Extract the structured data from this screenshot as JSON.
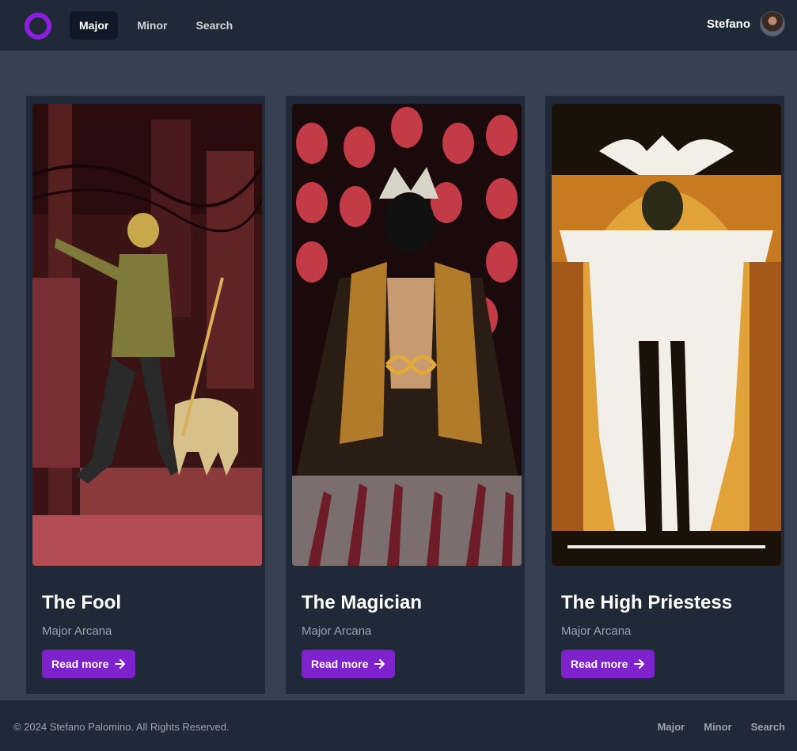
{
  "header": {
    "logo_icon": "ring-logo-icon",
    "nav": [
      {
        "label": "Major",
        "active": true
      },
      {
        "label": "Minor",
        "active": false
      },
      {
        "label": "Search",
        "active": false
      }
    ],
    "user_name": "Stefano"
  },
  "cards": [
    {
      "title": "The Fool",
      "subtitle": "Major Arcana",
      "button": "Read more"
    },
    {
      "title": "The Magician",
      "subtitle": "Major Arcana",
      "button": "Read more"
    },
    {
      "title": "The High Priestess",
      "subtitle": "Major Arcana",
      "button": "Read more"
    }
  ],
  "footer": {
    "copyright": "© 2024 Stefano Palomino. All Rights Reserved.",
    "nav": [
      "Major",
      "Minor",
      "Search"
    ]
  },
  "colors": {
    "accent": "#7e22ce",
    "logo": "#8b1ee0",
    "header_bg": "#1f2937",
    "page_bg": "#374151"
  }
}
